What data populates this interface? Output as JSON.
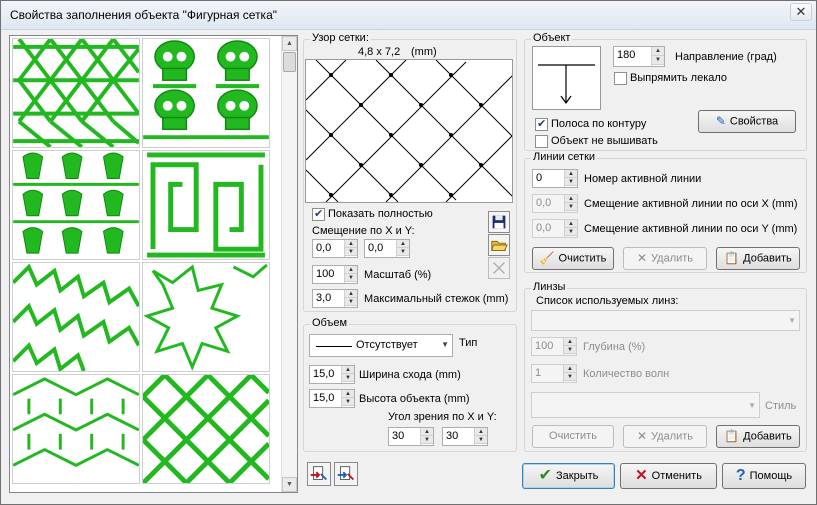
{
  "window": {
    "title": "Свойства заполнения объекта \"Фигурная сетка\"",
    "close_label": "✕"
  },
  "pattern": {
    "title": "Узор сетки:",
    "size": "4,8 x 7,2",
    "unit": "(mm)",
    "show_full_label": "Показать полностью",
    "show_full_checked": true,
    "offset_label": "Смещение по X и Y:",
    "offset_x": "0,0",
    "offset_y": "0,0",
    "scale_value": "100",
    "scale_label": "Масштаб (%)",
    "max_stitch_value": "3,0",
    "max_stitch_label": "Максимальный стежок (mm)"
  },
  "volume": {
    "title": "Объем",
    "type_value": "Отсутствует",
    "type_label": "Тип",
    "width_value": "15,0",
    "width_label": "Ширина схода (mm)",
    "height_value": "15,0",
    "height_label": "Высота объекта (mm)",
    "angle_label": "Угол зрения по X и Y:",
    "angle_x": "30",
    "angle_y": "30"
  },
  "object": {
    "title": "Объект",
    "direction_value": "180",
    "direction_label": "Направление (град)",
    "straighten_label": "Выпрямить лекало",
    "contour_strip_label": "Полоса по контуру",
    "contour_strip_checked": true,
    "no_embroider_label": "Объект не вышивать",
    "properties_label": "Свойства"
  },
  "grid_lines": {
    "title": "Линии сетки",
    "active_line_value": "0",
    "active_line_label": "Номер активной линии",
    "offset_x_value": "0,0",
    "offset_x_label": "Смещение активной линии по оси X (mm)",
    "offset_y_value": "0,0",
    "offset_y_label": "Смещение активной линии по оси Y (mm)",
    "clear_label": "Очистить",
    "delete_label": "Удалить",
    "add_label": "Добавить"
  },
  "lenses": {
    "title": "Линзы",
    "list_label": "Список используемых линз:",
    "depth_value": "100",
    "depth_label": "Глубина (%)",
    "waves_value": "1",
    "waves_label": "Количество волн",
    "style_label": "Стиль",
    "clear_label": "Очистить",
    "delete_label": "Удалить",
    "add_label": "Добавить"
  },
  "footer": {
    "close_label": "Закрыть",
    "cancel_label": "Отменить",
    "help_label": "Помощь"
  },
  "colors": {
    "pattern_green": "#22b81f",
    "accent_check": "#2a8a2a",
    "cancel_red": "#c0141c",
    "help_blue": "#1e5fbf"
  }
}
